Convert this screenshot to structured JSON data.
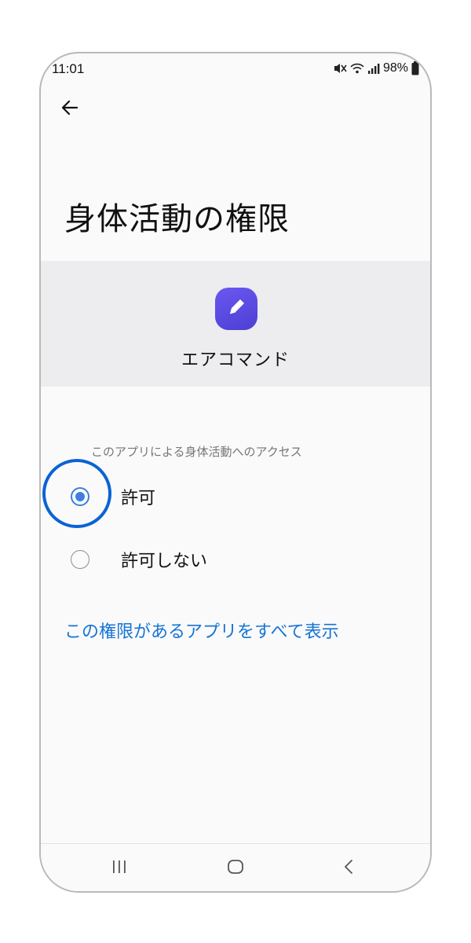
{
  "status_bar": {
    "time": "11:01",
    "battery": "98%",
    "icons": [
      "mute-icon",
      "wifi-icon",
      "signal-icon",
      "battery-icon"
    ]
  },
  "header": {
    "back_icon": "arrow-left-icon",
    "title": "身体活動の権限"
  },
  "app": {
    "name": "エアコマンド",
    "icon": "pencil-icon",
    "icon_color": "#5a4be6"
  },
  "permission": {
    "section_label": "このアプリによる身体活動へのアクセス",
    "options": [
      {
        "label": "許可",
        "selected": true
      },
      {
        "label": "許可しない",
        "selected": false
      }
    ],
    "accent_color": "#3d7ee6"
  },
  "link": {
    "label": "この権限があるアプリをすべて表示",
    "color": "#1674d6"
  },
  "nav_bar": {
    "buttons": [
      "recent-apps-icon",
      "home-icon",
      "back-icon"
    ]
  }
}
